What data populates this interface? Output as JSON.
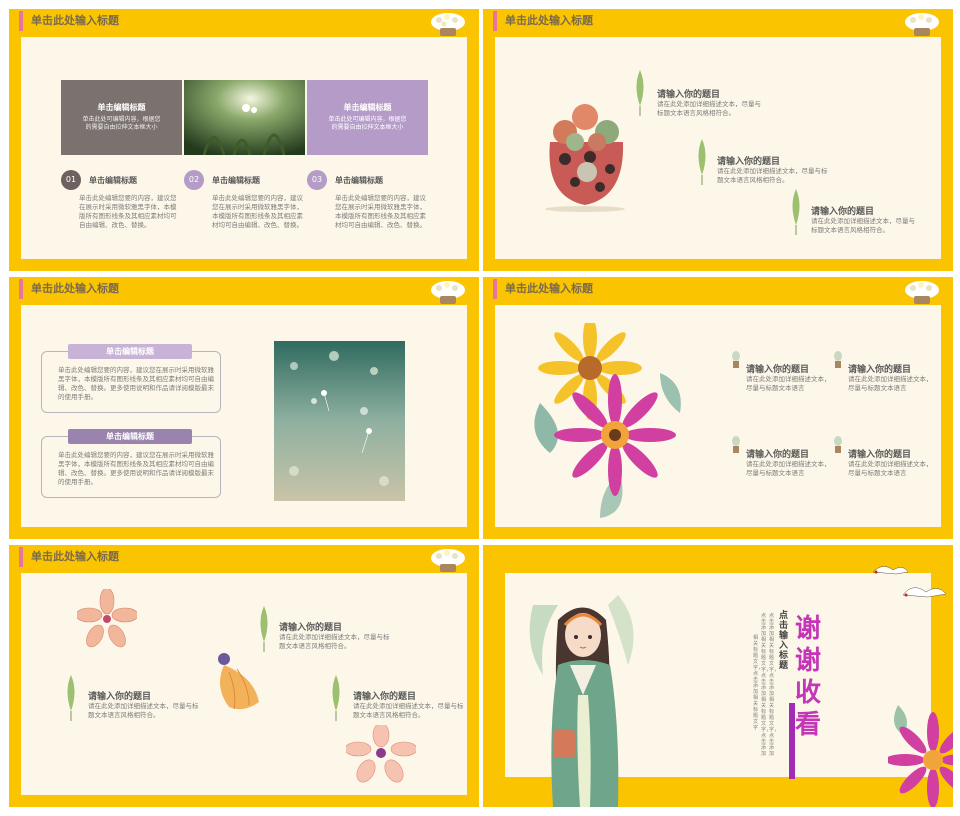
{
  "slides": {
    "s1": {
      "header": "单击此处输入标题",
      "box_left": {
        "title": "单击编辑标题",
        "body": "单击此处可编辑内容，根据您的需要自由拉伸文本框大小"
      },
      "box_right": {
        "title": "单击编辑标题",
        "body": "单击此处可编辑内容，根据您的需要自由拉伸文本框大小"
      },
      "items": [
        {
          "num": "01",
          "title": "单击编辑标题",
          "body": "单击此处编辑您要的内容，建议您在展示时采用微软雅黑字体，本模版所有图形线条及其相应素材均可自由编辑、改色、替换。"
        },
        {
          "num": "02",
          "title": "单击编辑标题",
          "body": "单击此处编辑您要的内容，建议您在展示时采用微软雅黑字体，本模版所有图形线条及其相应素材均可自由编辑、改色、替换。"
        },
        {
          "num": "03",
          "title": "单击编辑标题",
          "body": "单击此处编辑您要的内容，建议您在展示时采用微软雅黑字体，本模版所有图形线条及其相应素材均可自由编辑、改色、替换。"
        }
      ]
    },
    "s2": {
      "header": "单击此处输入标题",
      "items": [
        {
          "title": "请输入你的题目",
          "body": "请在此处添加详细描述文本，尽量与标题文本语言风格相符合。"
        },
        {
          "title": "请输入你的题目",
          "body": "请在此处添加详细描述文本，尽量与标题文本语言风格相符合。"
        },
        {
          "title": "请输入你的题目",
          "body": "请在此处添加详细描述文本，尽量与标题文本语言风格相符合。"
        }
      ]
    },
    "s3": {
      "header": "单击此处输入标题",
      "cards": [
        {
          "title": "单击编辑标题",
          "body": "单击此处编辑您要的内容，建议您在展示时采用微软雅黑字体，本模版所有图形线条及其相应素材均可自由编辑、改色、替换。更多使用说明和作品请详阅模版最末的使用手册。"
        },
        {
          "title": "单击编辑标题",
          "body": "单击此处编辑您要的内容，建议您在展示时采用微软雅黑字体，本模版所有图形线条及其相应素材均可自由编辑、改色、替换。更多使用说明和作品请详阅模版最末的使用手册。"
        }
      ]
    },
    "s4": {
      "header": "单击此处输入标题",
      "items": [
        {
          "title": "请输入你的题目",
          "body": "请在此处添加详细描述文本，尽量与标题文本语言"
        },
        {
          "title": "请输入你的题目",
          "body": "请在此处添加详细描述文本，尽量与标题文本语言"
        },
        {
          "title": "请输入你的题目",
          "body": "请在此处添加详细描述文本，尽量与标题文本语言"
        },
        {
          "title": "请输入你的题目",
          "body": "请在此处添加详细描述文本，尽量与标题文本语言"
        }
      ]
    },
    "s5": {
      "header": "单击此处输入标题",
      "items": [
        {
          "title": "请输入你的题目",
          "body": "请在此处添加详细描述文本，尽量与标题文本语言风格相符合。"
        },
        {
          "title": "请输入你的题目",
          "body": "请在此处添加详细描述文本，尽量与标题文本语言风格相符合。"
        },
        {
          "title": "请输入你的题目",
          "body": "请在此处添加详细描述文本，尽量与标题文本语言风格相符合。"
        }
      ]
    },
    "s6": {
      "thanks": "谢谢收看",
      "subtitle": "点击输入标题",
      "body_col1": "点击添加相关标题文字，点击添加相关标题文字，点击添加",
      "body_col2": "点击添加相关标题文字，点击添加相关标题文字，点击添加",
      "body_col3": "相关标题文字，点击添加相关标题文字"
    }
  },
  "colors": {
    "frame": "#fbc400",
    "panel": "#fdf7e9",
    "accent_pink": "#e8759b",
    "lavender": "#b59bc8",
    "gray_box": "#7b7270",
    "magenta": "#c436b7"
  }
}
